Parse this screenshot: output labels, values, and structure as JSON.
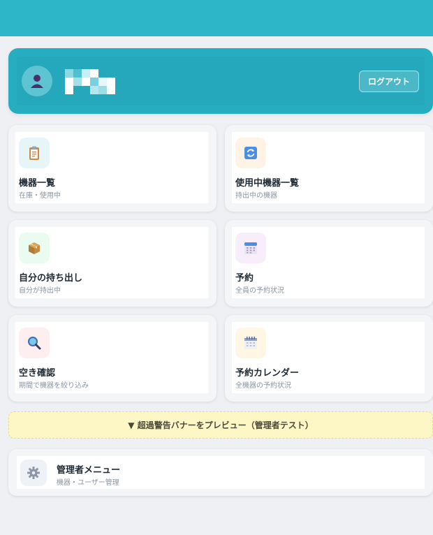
{
  "user": {
    "logout_label": "ログアウト"
  },
  "menu": [
    {
      "title": "機器一覧",
      "sub": "在庫・使用中",
      "icon": "clipboard-icon"
    },
    {
      "title": "使用中機器一覧",
      "sub": "持出中の機器",
      "icon": "refresh-icon"
    },
    {
      "title": "自分の持ち出し",
      "sub": "自分が持出中",
      "icon": "package-icon"
    },
    {
      "title": "予約",
      "sub": "全員の予約状況",
      "icon": "calendar-icon"
    },
    {
      "title": "空き確認",
      "sub": "期間で機器を絞り込み",
      "icon": "magnifier-icon"
    },
    {
      "title": "予約カレンダー",
      "sub": "全機器の予約状況",
      "icon": "spiral-calendar-icon"
    }
  ],
  "warning": {
    "label": "▼ 超過警告バナーをプレビュー（管理者テスト）"
  },
  "admin": {
    "title": "管理者メニュー",
    "sub": "機器・ユーザー管理",
    "icon": "gear-icon"
  },
  "colors": {
    "header": "#2db5c8",
    "user_card": "#27adc0",
    "warning_bg": "#fdf7c6"
  }
}
